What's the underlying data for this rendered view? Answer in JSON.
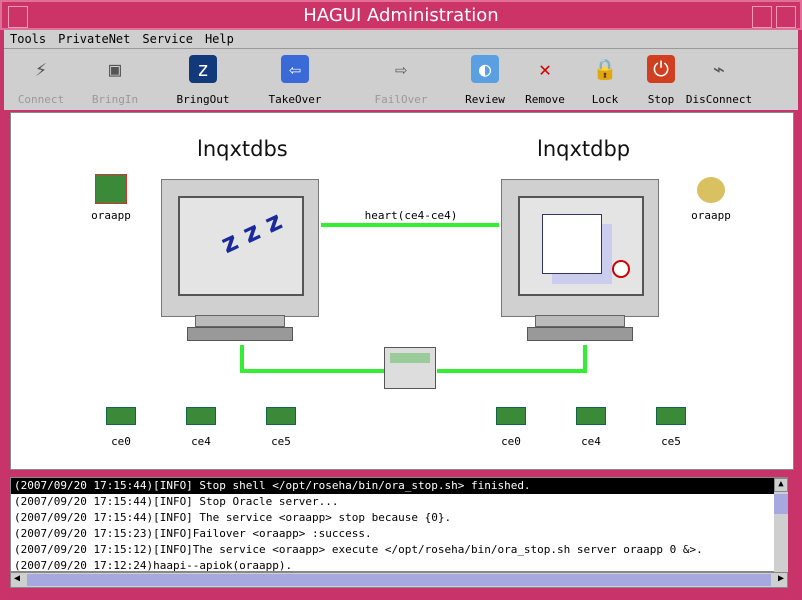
{
  "window": {
    "title": "HAGUI Administration"
  },
  "menu": [
    "Tools",
    "PrivateNet",
    "Service",
    "Help"
  ],
  "toolbar": [
    {
      "label": "Connect",
      "icon": "lightning-icon",
      "enabled": false
    },
    {
      "label": "BringIn",
      "icon": "monitor-icon",
      "enabled": false
    },
    {
      "label": "BringOut",
      "icon": "sleep-monitor-icon",
      "enabled": true
    },
    {
      "label": "TakeOver",
      "icon": "gear-arrow-left-icon",
      "enabled": true
    },
    {
      "label": "FailOver",
      "icon": "gear-arrow-right-icon",
      "enabled": false
    },
    {
      "label": "Review",
      "icon": "globe-icon",
      "enabled": true
    },
    {
      "label": "Remove",
      "icon": "x-icon",
      "enabled": true
    },
    {
      "label": "Lock",
      "icon": "padlock-icon",
      "enabled": true
    },
    {
      "label": "Stop",
      "icon": "power-icon",
      "enabled": true
    },
    {
      "label": "DisConnect",
      "icon": "unplug-icon",
      "enabled": true
    }
  ],
  "hosts": [
    {
      "name": "lnqxtdbs",
      "service": "oraapp",
      "state": "sleeping",
      "nics": [
        "ce0",
        "ce4",
        "ce5"
      ]
    },
    {
      "name": "lnqxtdbp",
      "service": "oraapp",
      "state": "running",
      "nics": [
        "ce0",
        "ce4",
        "ce5"
      ]
    }
  ],
  "heartbeat": "heart(ce4-ce4)",
  "log": [
    "(2007/09/20 17:15:44)[INFO] Stop shell </opt/roseha/bin/ora_stop.sh> finished.",
    "(2007/09/20 17:15:44)[INFO] Stop Oracle server...",
    "(2007/09/20 17:15:44)[INFO] The service <oraapp> stop because {0}.",
    "(2007/09/20 17:15:23)[INFO]Failover <oraapp> :success.",
    "(2007/09/20 17:15:12)[INFO]The service <oraapp> execute </opt/roseha/bin/ora_stop.sh server oraapp 0 &>.",
    "(2007/09/20 17:12:24)haapi--apiok(oraapp)."
  ],
  "colors": {
    "title_bar": "#cc3366",
    "link": "#33ee33"
  }
}
